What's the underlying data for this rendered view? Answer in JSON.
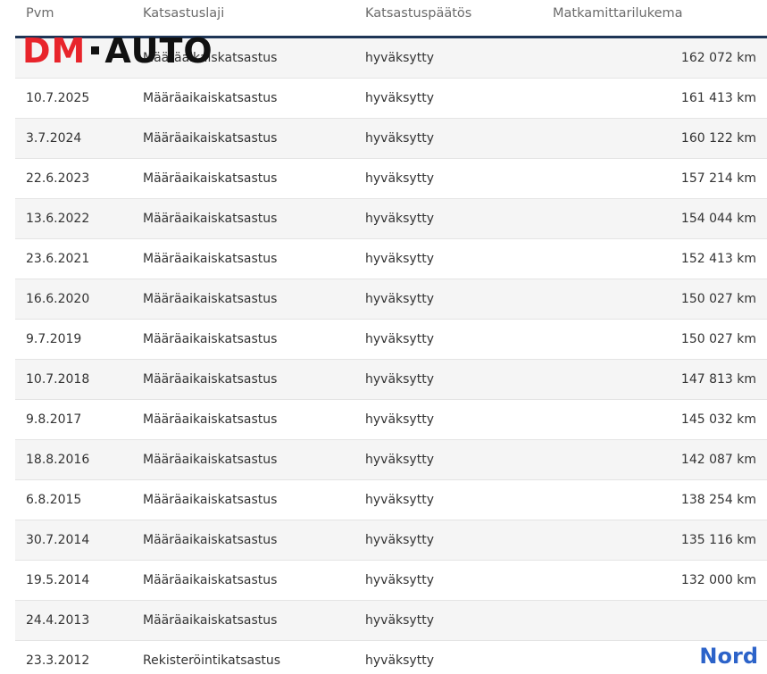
{
  "table": {
    "headers": {
      "date": "Pvm",
      "type": "Katsastuslaji",
      "result": "Katsastuspäätös",
      "odometer": "Matkamittarilukema"
    },
    "rows": [
      {
        "date": "",
        "type": "Määräaikaiskatsastus",
        "result": "hyväksytty",
        "km": "162 072 km"
      },
      {
        "date": "10.7.2025",
        "type": "Määräaikaiskatsastus",
        "result": "hyväksytty",
        "km": "161 413 km"
      },
      {
        "date": "3.7.2024",
        "type": "Määräaikaiskatsastus",
        "result": "hyväksytty",
        "km": "160 122 km"
      },
      {
        "date": "22.6.2023",
        "type": "Määräaikaiskatsastus",
        "result": "hyväksytty",
        "km": "157 214 km"
      },
      {
        "date": "13.6.2022",
        "type": "Määräaikaiskatsastus",
        "result": "hyväksytty",
        "km": "154 044 km"
      },
      {
        "date": "23.6.2021",
        "type": "Määräaikaiskatsastus",
        "result": "hyväksytty",
        "km": "152 413 km"
      },
      {
        "date": "16.6.2020",
        "type": "Määräaikaiskatsastus",
        "result": "hyväksytty",
        "km": "150 027 km"
      },
      {
        "date": "9.7.2019",
        "type": "Määräaikaiskatsastus",
        "result": "hyväksytty",
        "km": "150 027 km"
      },
      {
        "date": "10.7.2018",
        "type": "Määräaikaiskatsastus",
        "result": "hyväksytty",
        "km": "147 813 km"
      },
      {
        "date": "9.8.2017",
        "type": "Määräaikaiskatsastus",
        "result": "hyväksytty",
        "km": "145 032 km"
      },
      {
        "date": "18.8.2016",
        "type": "Määräaikaiskatsastus",
        "result": "hyväksytty",
        "km": "142 087 km"
      },
      {
        "date": "6.8.2015",
        "type": "Määräaikaiskatsastus",
        "result": "hyväksytty",
        "km": "138 254 km"
      },
      {
        "date": "30.7.2014",
        "type": "Määräaikaiskatsastus",
        "result": "hyväksytty",
        "km": "135 116 km"
      },
      {
        "date": "19.5.2014",
        "type": "Määräaikaiskatsastus",
        "result": "hyväksytty",
        "km": "132 000 km"
      },
      {
        "date": "24.4.2013",
        "type": "Määräaikaiskatsastus",
        "result": "hyväksytty",
        "km": ""
      },
      {
        "date": "23.3.2012",
        "type": "Rekisteröintikatsastus",
        "result": "hyväksytty",
        "km": ""
      }
    ]
  },
  "logo": {
    "part1": "DM",
    "part2": "AUTO"
  },
  "watermark": "Nord",
  "colors": {
    "header_rule": "#1e3556",
    "logo_red": "#e8242b",
    "watermark_blue": "#2c63c9",
    "row_alt": "#f5f5f5"
  }
}
